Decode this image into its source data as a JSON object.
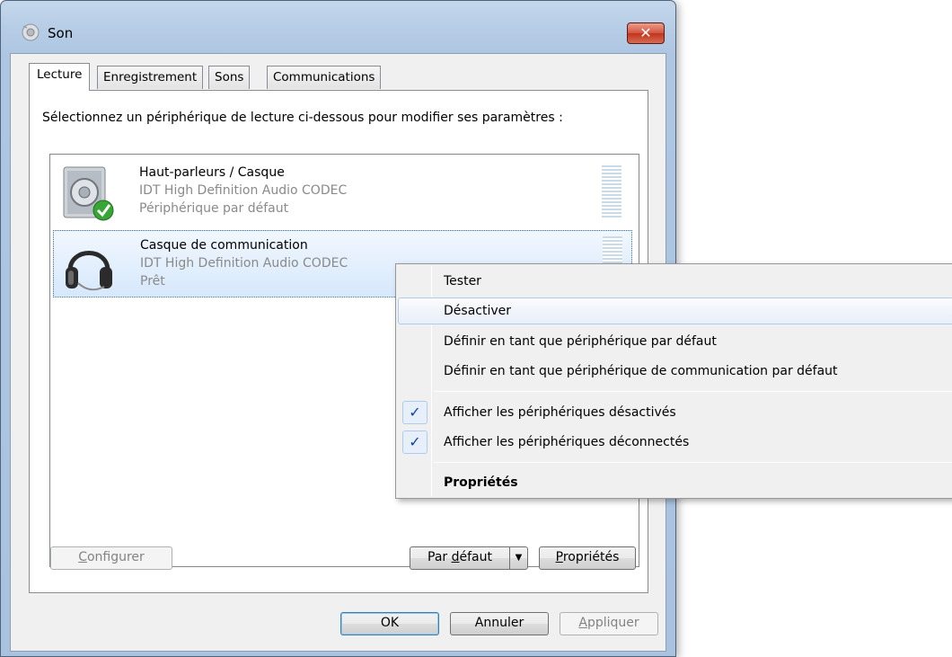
{
  "window": {
    "title": "Son",
    "close_label": "✕"
  },
  "tabs": [
    {
      "label": "Lecture"
    },
    {
      "label": "Enregistrement"
    },
    {
      "label": "Sons"
    },
    {
      "label": "Communications"
    }
  ],
  "panel": {
    "instruction": "Sélectionnez un périphérique de lecture ci-dessous pour modifier ses paramètres :"
  },
  "devices": [
    {
      "name": "Haut-parleurs / Casque",
      "driver": "IDT High Definition Audio CODEC",
      "status": "Périphérique par défaut",
      "icon": "speaker-icon",
      "default": true
    },
    {
      "name": "Casque de communication",
      "driver": "IDT High Definition Audio CODEC",
      "status": "Prêt",
      "icon": "headset-icon",
      "selected": true
    }
  ],
  "buttons": {
    "configure_pre": "",
    "configure_u": "C",
    "configure_post": "onfigurer",
    "default_pre": "Par ",
    "default_u": "d",
    "default_post": "éfaut",
    "properties_pre": "",
    "properties_u": "P",
    "properties_post": "ropriétés",
    "ok": "OK",
    "cancel": "Annuler",
    "apply_pre": "",
    "apply_u": "A",
    "apply_post": "ppliquer"
  },
  "context_menu": {
    "items": [
      {
        "label": "Tester"
      },
      {
        "label": "Désactiver",
        "highlighted": true
      },
      {
        "label": "Définir en tant que périphérique par défaut"
      },
      {
        "label": "Définir en tant que périphérique de communication par défaut"
      },
      {
        "label": "Afficher les périphériques désactivés",
        "checked": true
      },
      {
        "label": "Afficher les périphériques déconnectés",
        "checked": true
      },
      {
        "label": "Propriétés",
        "bold": true
      }
    ],
    "check_glyph": "✓"
  }
}
